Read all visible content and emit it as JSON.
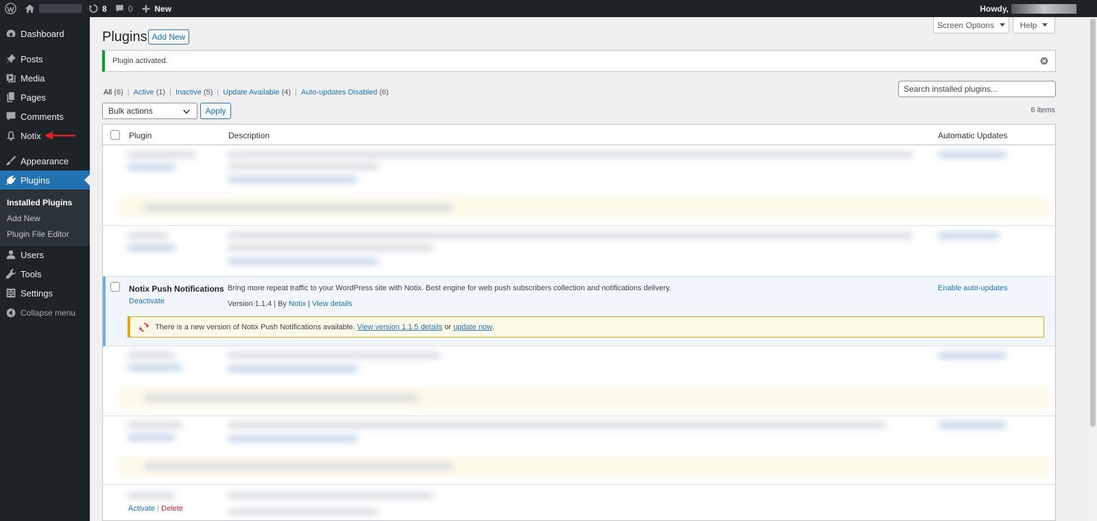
{
  "adminbar": {
    "updates_count": "8",
    "comments_count": "0",
    "new_label": "New",
    "howdy": "Howdy,"
  },
  "sidebar": {
    "items": [
      {
        "label": "Dashboard",
        "icon": "dashboard-icon"
      },
      {
        "label": "Posts",
        "icon": "pin-icon"
      },
      {
        "label": "Media",
        "icon": "media-icon"
      },
      {
        "label": "Pages",
        "icon": "pages-icon"
      },
      {
        "label": "Comments",
        "icon": "comment-icon"
      },
      {
        "label": "Notix",
        "icon": "bell-icon"
      },
      {
        "label": "Appearance",
        "icon": "brush-icon"
      },
      {
        "label": "Plugins",
        "icon": "plug-icon"
      },
      {
        "label": "Users",
        "icon": "user-icon"
      },
      {
        "label": "Tools",
        "icon": "wrench-icon"
      },
      {
        "label": "Settings",
        "icon": "settings-icon"
      },
      {
        "label": "Collapse menu",
        "icon": "collapse-icon"
      }
    ],
    "submenu": [
      "Installed Plugins",
      "Add New",
      "Plugin File Editor"
    ]
  },
  "header": {
    "screen_options": "Screen Options",
    "help": "Help",
    "title": "Plugins",
    "add_new": "Add New"
  },
  "notice": {
    "text": "Plugin activated."
  },
  "filters": [
    {
      "label": "All",
      "count": "(6)"
    },
    {
      "label": "Active",
      "count": "(1)"
    },
    {
      "label": "Inactive",
      "count": "(5)"
    },
    {
      "label": "Update Available",
      "count": "(4)"
    },
    {
      "label": "Auto-updates Disabled",
      "count": "(6)"
    }
  ],
  "search": {
    "placeholder": "Search installed plugins..."
  },
  "bulk": {
    "selected": "Bulk actions",
    "apply": "Apply",
    "items_count": "6 items"
  },
  "table": {
    "columns": [
      "Plugin",
      "Description",
      "Automatic Updates"
    ],
    "notix": {
      "name": "Notix Push Notifications",
      "deactivate": "Deactivate",
      "description": "Bring more repeat traffic to your WordPress site with Notix. Best engine for web push subscribers collection and notifications delivery.",
      "version": "Version 1.1.4",
      "by": "By",
      "author": "Notix",
      "view_details": "View details",
      "auto_updates": "Enable auto-updates",
      "update_text_1": "There is a new version of Notix Push Notifications available.",
      "update_link": "View version 1.1.5 details",
      "update_or": "or",
      "update_now": "update now",
      "update_end": "."
    },
    "last_row": {
      "activate": "Activate",
      "delete": "Delete"
    }
  },
  "colors": {
    "adminbar_bg": "#1d2327",
    "accent": "#2271b1",
    "success": "#00a32a",
    "warning": "#dba617",
    "update_icon": "#d63638"
  }
}
